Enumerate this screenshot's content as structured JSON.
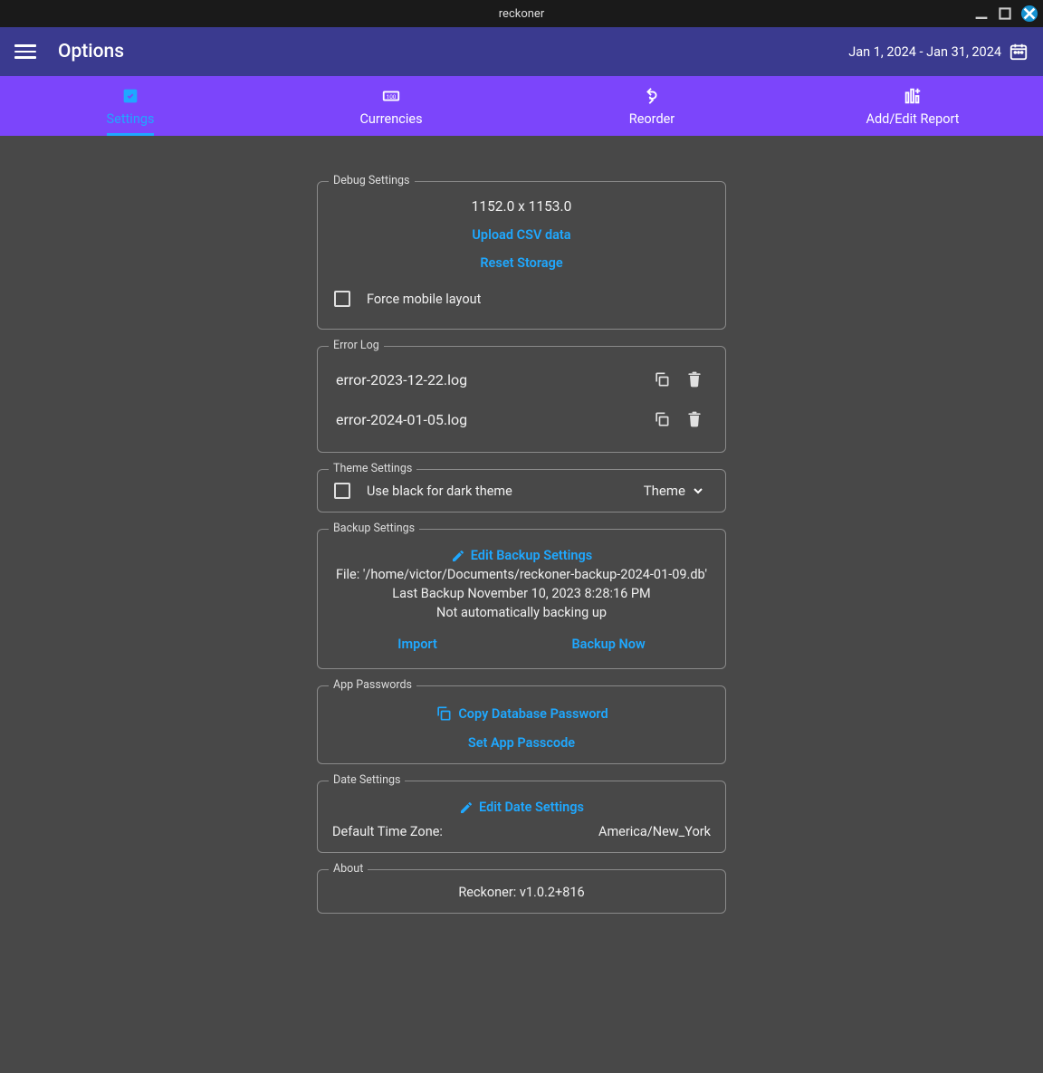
{
  "window": {
    "title": "reckoner"
  },
  "header": {
    "title": "Options",
    "date_range": "Jan 1, 2024 - Jan 31, 2024"
  },
  "tabs": [
    {
      "label": "Settings"
    },
    {
      "label": "Currencies"
    },
    {
      "label": "Reorder"
    },
    {
      "label": "Add/Edit Report"
    }
  ],
  "sections": {
    "debug": {
      "legend": "Debug Settings",
      "dimensions": "1152.0 x 1153.0",
      "upload_csv": "Upload CSV data",
      "reset_storage": "Reset Storage",
      "force_mobile": "Force mobile layout"
    },
    "error_log": {
      "legend": "Error Log",
      "items": [
        "error-2023-12-22.log",
        "error-2024-01-05.log"
      ]
    },
    "theme": {
      "legend": "Theme Settings",
      "use_black": "Use black for dark theme",
      "theme_label": "Theme"
    },
    "backup": {
      "legend": "Backup Settings",
      "edit": "Edit Backup Settings",
      "file": "File: '/home/victor/Documents/reckoner-backup-2024-01-09.db'",
      "last": "Last Backup November 10, 2023 8:28:16 PM",
      "auto": "Not automatically backing up",
      "import": "Import",
      "backup_now": "Backup Now"
    },
    "passwords": {
      "legend": "App Passwords",
      "copy_db": "Copy Database Password",
      "set_passcode": "Set App Passcode"
    },
    "date": {
      "legend": "Date Settings",
      "edit": "Edit Date Settings",
      "tz_label": "Default Time Zone:",
      "tz_value": "America/New_York"
    },
    "about": {
      "legend": "About",
      "version": "Reckoner: v1.0.2+816"
    }
  }
}
